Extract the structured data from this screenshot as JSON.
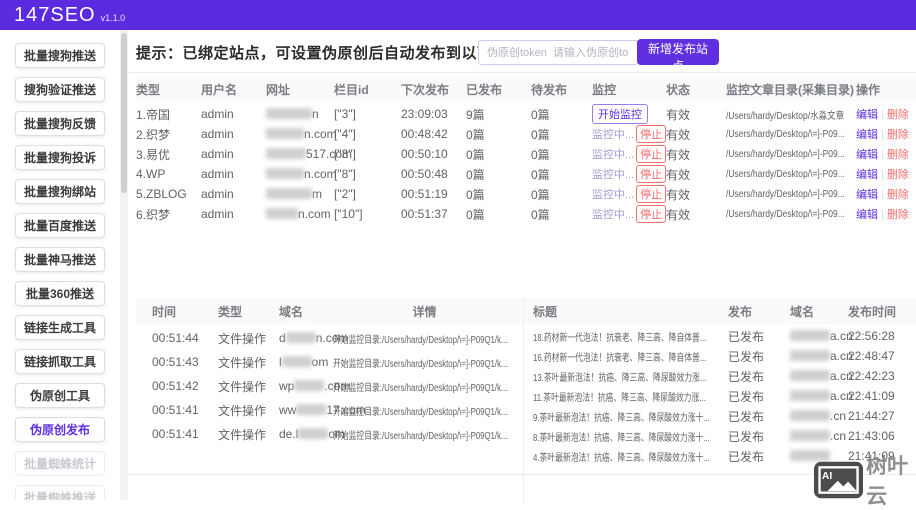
{
  "header": {
    "title": "147SEO",
    "version": "v1.1.0"
  },
  "sidebar": {
    "items": [
      {
        "label": "批量搜狗推送",
        "state": "normal"
      },
      {
        "label": "搜狗验证推送",
        "state": "normal"
      },
      {
        "label": "批量搜狗反馈",
        "state": "normal"
      },
      {
        "label": "批量搜狗投诉",
        "state": "normal"
      },
      {
        "label": "批量搜狗绑站",
        "state": "normal"
      },
      {
        "label": "批量百度推送",
        "state": "normal"
      },
      {
        "label": "批量神马推送",
        "state": "normal"
      },
      {
        "label": "批量360推送",
        "state": "normal"
      },
      {
        "label": "链接生成工具",
        "state": "normal"
      },
      {
        "label": "链接抓取工具",
        "state": "normal"
      },
      {
        "label": "伪原创工具",
        "state": "normal"
      },
      {
        "label": "伪原创发布",
        "state": "active"
      },
      {
        "label": "批量蜘蛛统计",
        "state": "disabled"
      },
      {
        "label": "批量蜘蛛推送",
        "state": "disabled"
      }
    ]
  },
  "main": {
    "tip": "提示：已绑定站点，可设置伪原创后自动发布到以下站点",
    "token_input": {
      "placeholder": "伪原创token  请输入伪原创token"
    },
    "add_site_button": "新增发布站点"
  },
  "sites_table": {
    "headers": [
      "类型",
      "用户名",
      "网址",
      "栏目id",
      "下次发布",
      "已发布",
      "待发布",
      "监控",
      "状态",
      "监控文章目录(采集目录)",
      "操作"
    ],
    "monitor": {
      "start_label": "开始监控",
      "monitoring_label": "监控中...",
      "stop_label": "停止"
    },
    "actions": {
      "edit": "编辑",
      "sep": "|",
      "delete": "删除"
    },
    "rows": [
      {
        "type": "1.帝国",
        "user": "admin",
        "url_suffix": "n",
        "col_id": "[\"3\"]",
        "next_pub": "23:09:03",
        "published": "9篇",
        "pending": "0篇",
        "monitor": "start",
        "status": "有效",
        "dir": "/Users/hardy/Desktop/水淼文章"
      },
      {
        "type": "2.织梦",
        "user": "admin",
        "url_suffix": "n.com",
        "col_id": "[\"4\"]",
        "next_pub": "00:48:42",
        "published": "0篇",
        "pending": "0篇",
        "monitor": "monitoring",
        "status": "有效",
        "dir": "/Users/hardy/Desktop/\\=]-P09..."
      },
      {
        "type": "3.易优",
        "user": "admin",
        "url_suffix": "517.com",
        "col_id": "[\"3\"]",
        "next_pub": "00:50:10",
        "published": "0篇",
        "pending": "0篇",
        "monitor": "monitoring",
        "status": "有效",
        "dir": "/Users/hardy/Desktop/\\=]-P09..."
      },
      {
        "type": "4.WP",
        "user": "admin",
        "url_suffix": "n.com",
        "col_id": "[\"8\"]",
        "next_pub": "00:50:48",
        "published": "0篇",
        "pending": "0篇",
        "monitor": "monitoring",
        "status": "有效",
        "dir": "/Users/hardy/Desktop/\\=]-P09..."
      },
      {
        "type": "5.ZBLOG",
        "user": "admin",
        "url_suffix": "m",
        "col_id": "[\"2\"]",
        "next_pub": "00:51:19",
        "published": "0篇",
        "pending": "0篇",
        "monitor": "monitoring",
        "status": "有效",
        "dir": "/Users/hardy/Desktop/\\=]-P09..."
      },
      {
        "type": "6.织梦",
        "user": "admin",
        "url_suffix": "n.com",
        "col_id": "[\"10\"]",
        "next_pub": "00:51:37",
        "published": "0篇",
        "pending": "0篇",
        "monitor": "monitoring",
        "status": "有效",
        "dir": "/Users/hardy/Desktop/\\=]-P09..."
      }
    ]
  },
  "log_table": {
    "left_headers": [
      "时间",
      "类型",
      "域名",
      "详情"
    ],
    "right_headers": [
      "标题",
      "发布",
      "域名",
      "发布时间"
    ],
    "left_rows": [
      {
        "time": "00:51:44",
        "type": "文件操作",
        "domain_prefix": "d",
        "domain_suffix": "n.com",
        "detail": "开始监控目录:/Users/hardy/Desktop/\\=]-P09Q1/k..."
      },
      {
        "time": "00:51:43",
        "type": "文件操作",
        "domain_prefix": "l",
        "domain_suffix": "om",
        "detail": "开始监控目录:/Users/hardy/Desktop/\\=]-P09Q1/k..."
      },
      {
        "time": "00:51:42",
        "type": "文件操作",
        "domain_prefix": "wp",
        "domain_suffix": ".com",
        "detail": "开始监控目录:/Users/hardy/Desktop/\\=]-P09Q1/k..."
      },
      {
        "time": "00:51:41",
        "type": "文件操作",
        "domain_prefix": "ww",
        "domain_suffix": "17.com",
        "detail": "开始监控目录:/Users/hardy/Desktop/\\=]-P09Q1/k..."
      },
      {
        "time": "00:51:41",
        "type": "文件操作",
        "domain_prefix": "de.l",
        "domain_suffix": "om",
        "detail": "开始监控目录:/Users/hardy/Desktop/\\=]-P09Q1/k..."
      }
    ],
    "right_rows": [
      {
        "title": "18.药材新一代泡法！抗衰老、降三高、降自体普...",
        "pub": "已发布",
        "domain_suffix": "a.cn",
        "time": "22:56:28"
      },
      {
        "title": "16.药材新一代泡法！抗衰老、降三高、降自体普...",
        "pub": "已发布",
        "domain_suffix": "a.cn",
        "time": "22:48:47"
      },
      {
        "title": "13.茶叶最新泡法！抗癌、降三高、降尿酸效力涨...",
        "pub": "已发布",
        "domain_suffix": "a.cn",
        "time": "22:42:23"
      },
      {
        "title": "11.茶叶最新泡法！抗癌、降三高、降尿酸效力涨...",
        "pub": "已发布",
        "domain_suffix": "a.cn",
        "time": "22:41:09"
      },
      {
        "title": "9.茶叶最新泡法！抗癌、降三高、降尿酸效力涨十...",
        "pub": "已发布",
        "domain_suffix": ".cn",
        "time": "21:44:27"
      },
      {
        "title": "8.茶叶最新泡法！抗癌、降三高、降尿酸效力涨十...",
        "pub": "已发布",
        "domain_suffix": ".cn",
        "time": "21:43:06"
      },
      {
        "title": "4.茶叶最新泡法！抗癌、降三高、降尿酸效力涨十...",
        "pub": "已发布",
        "domain_suffix": "",
        "time": "21:41:09"
      }
    ]
  },
  "watermark": {
    "icon_label": "AI",
    "label": "树叶云"
  },
  "colors": {
    "header_bg": "#5c2be0",
    "accent": "#6030e0",
    "danger": "#f56c6c"
  }
}
